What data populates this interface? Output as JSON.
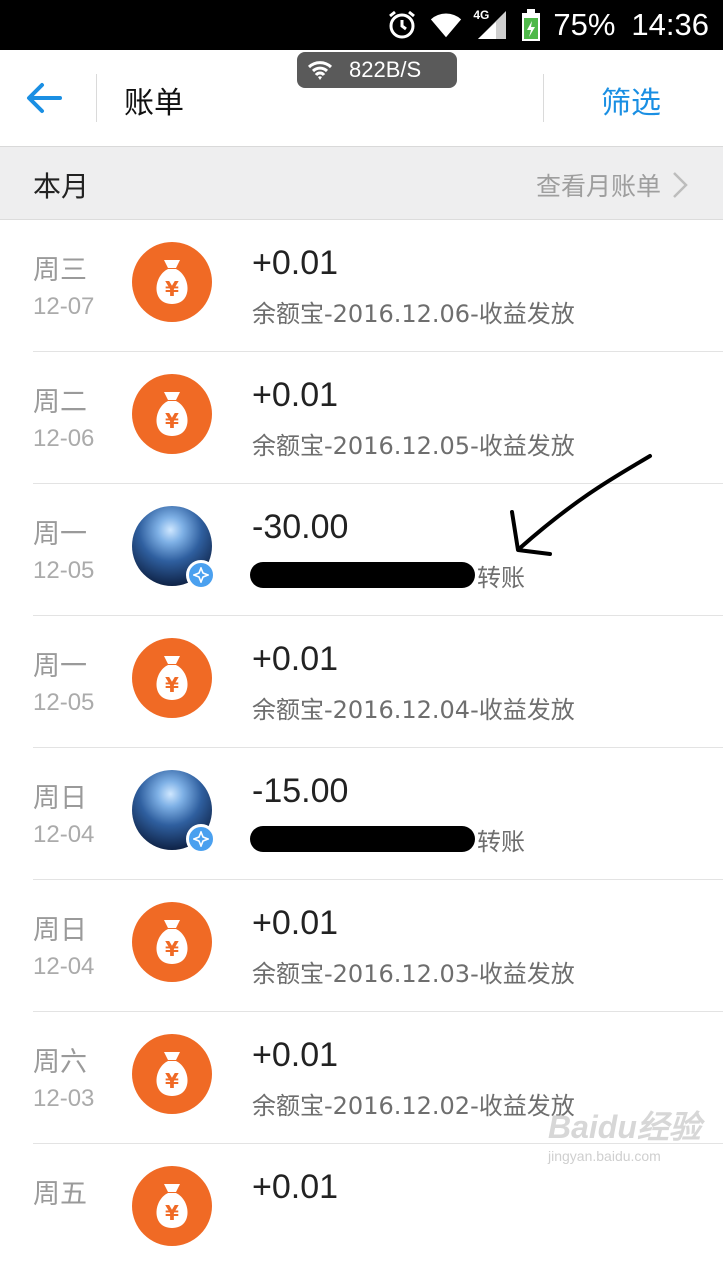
{
  "status_bar": {
    "battery": "75%",
    "time": "14:36",
    "network_type": "4G"
  },
  "net_speed": "822B/S",
  "header": {
    "title": "账单",
    "filter_label": "筛选"
  },
  "month_section": {
    "label": "本月",
    "link": "查看月账单"
  },
  "transactions": [
    {
      "weekday": "周三",
      "date": "12-07",
      "amount": "+0.01",
      "desc": "余额宝-2016.12.06-收益发放",
      "icon": "money-bag-icon"
    },
    {
      "weekday": "周二",
      "date": "12-06",
      "amount": "+0.01",
      "desc": "余额宝-2016.12.05-收益发放",
      "icon": "money-bag-icon"
    },
    {
      "weekday": "周一",
      "date": "12-05",
      "amount": "-30.00",
      "desc": "转账",
      "icon": "user-avatar"
    },
    {
      "weekday": "周一",
      "date": "12-05",
      "amount": "+0.01",
      "desc": "余额宝-2016.12.04-收益发放",
      "icon": "money-bag-icon"
    },
    {
      "weekday": "周日",
      "date": "12-04",
      "amount": "-15.00",
      "desc": "转账",
      "icon": "user-avatar"
    },
    {
      "weekday": "周日",
      "date": "12-04",
      "amount": "+0.01",
      "desc": "余额宝-2016.12.03-收益发放",
      "icon": "money-bag-icon"
    },
    {
      "weekday": "周六",
      "date": "12-03",
      "amount": "+0.01",
      "desc": "余额宝-2016.12.02-收益发放",
      "icon": "money-bag-icon"
    },
    {
      "weekday": "周五",
      "date": "",
      "amount": "+0.01",
      "desc": "",
      "icon": "money-bag-icon"
    }
  ],
  "watermark": {
    "main": "Baidu经验",
    "sub": "jingyan.baidu.com"
  },
  "colors": {
    "accent": "#1a8fe3",
    "icon_orange": "#f06a25",
    "status_bar": "#000000"
  }
}
